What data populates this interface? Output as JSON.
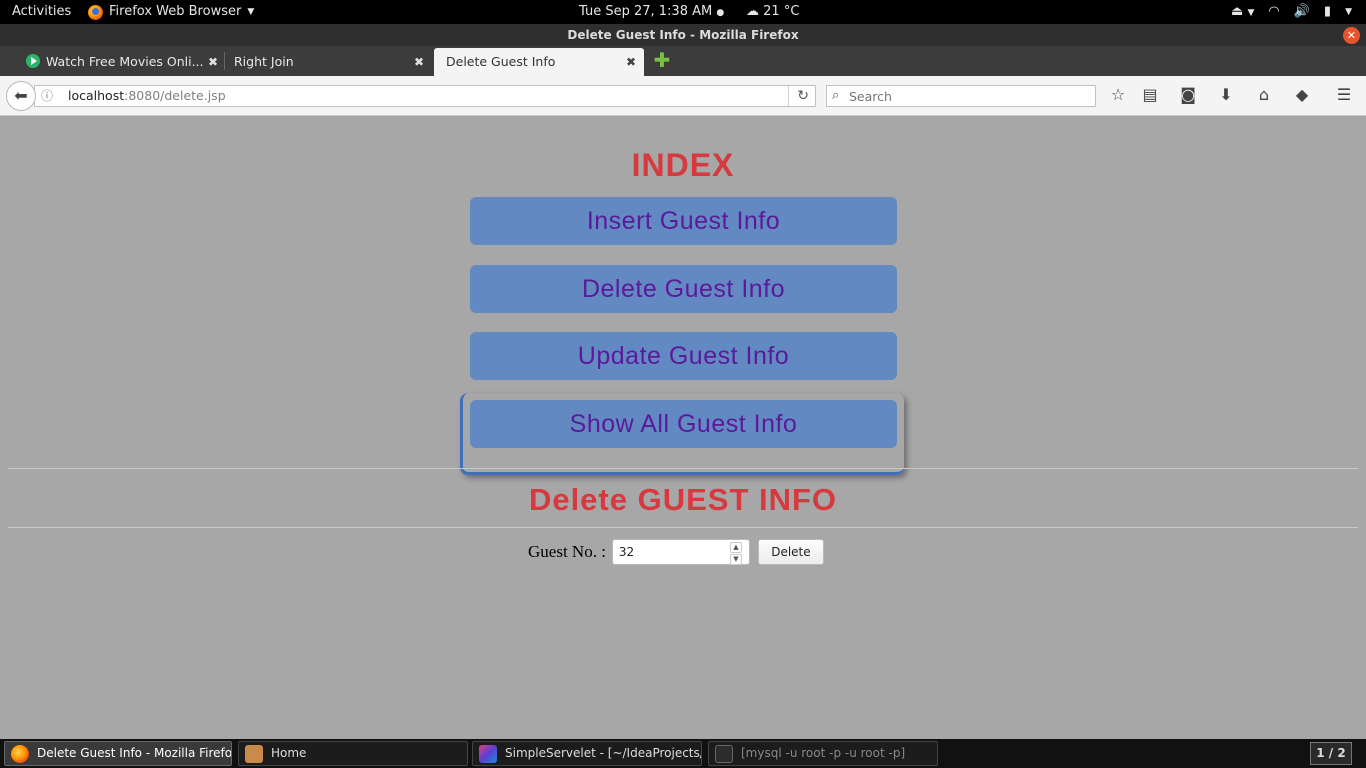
{
  "system_bar": {
    "activities": "Activities",
    "app_name": "Firefox Web Browser",
    "clock": "Tue Sep 27,  1:38 AM",
    "weather": "21 °C"
  },
  "window": {
    "title": "Delete Guest Info - Mozilla Firefox"
  },
  "tabs": [
    {
      "label": "Watch Free Movies Onli..."
    },
    {
      "label": "Right Join"
    },
    {
      "label": "Delete Guest Info"
    }
  ],
  "navbar": {
    "url_host": "localhost",
    "url_path": ":8080/delete.jsp",
    "search_placeholder": "Search"
  },
  "page": {
    "index_title": "INDEX",
    "menu": [
      {
        "label": "Insert Guest Info"
      },
      {
        "label": "Delete Guest Info"
      },
      {
        "label": "Update Guest Info"
      },
      {
        "label": "Show All Guest Info"
      }
    ],
    "delete_title": "Delete GUEST INFO",
    "guest_label": "Guest No. :",
    "guest_value": "32",
    "delete_button": "Delete"
  },
  "taskbar": {
    "items": [
      {
        "label": "Delete Guest Info - Mozilla Firefox"
      },
      {
        "label": "Home"
      },
      {
        "label": "SimpleServelet - [~/IdeaProjects/..."
      },
      {
        "label": "[mysql -u root -p -u root -p]"
      }
    ],
    "pager": "1 / 2"
  },
  "colors": {
    "title_red": "#d6393e",
    "button_blue": "#6389c3",
    "button_text_purple": "#5a1a9a",
    "page_background": "#a7a7a7"
  }
}
